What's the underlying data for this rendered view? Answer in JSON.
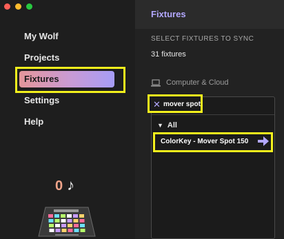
{
  "window": {
    "controls": [
      "close",
      "minimize",
      "zoom"
    ]
  },
  "sidebar": {
    "items": [
      {
        "label": "My Wolf",
        "selected": false
      },
      {
        "label": "Projects",
        "selected": false
      },
      {
        "label": "Fixtures",
        "selected": true
      },
      {
        "label": "Settings",
        "selected": false
      },
      {
        "label": "Help",
        "selected": false
      }
    ],
    "counter": {
      "value": "0",
      "note_icon": "music-note-icon",
      "note_glyph": "♪"
    },
    "device_icon": "midi-controller-icon"
  },
  "panel": {
    "title": "Fixtures",
    "sync_label": "SELECT FIXTURES TO SYNC",
    "fixture_count": "31 fixtures",
    "source": {
      "icon": "laptop-icon",
      "label": "Computer & Cloud"
    },
    "search": {
      "clear_icon": "close-icon",
      "value": "mover spot"
    },
    "group": {
      "caret_icon": "caret-down-icon",
      "label": "All"
    },
    "results": [
      {
        "label": "ColorKey - Mover Spot 150",
        "action_icon": "arrow-right-icon"
      }
    ]
  },
  "colors": {
    "accent": "#b3a8ff",
    "highlight": "#f3f01c",
    "counter": "#f0a48a",
    "selected_gradient_start": "#e4969a",
    "selected_gradient_end": "#a69cf6"
  }
}
